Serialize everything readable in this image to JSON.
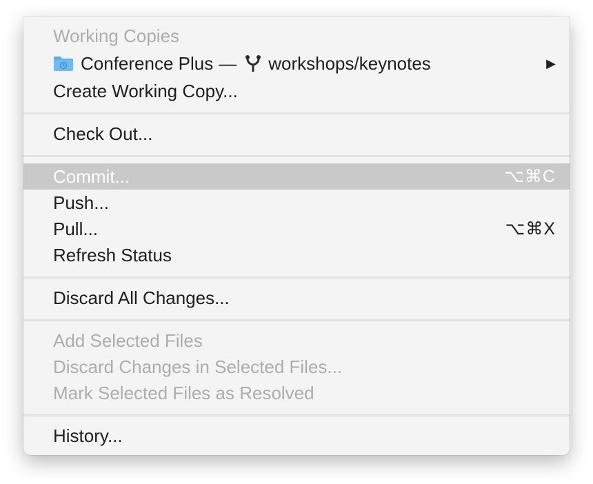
{
  "menu": {
    "header": "Working Copies",
    "working_copy": {
      "icon": "folder-icon",
      "name": "Conference Plus",
      "dash": "—",
      "branch_icon": "branch-icon",
      "branch": "workshops/keynotes",
      "submenu_indicator": "▶"
    },
    "create_working_copy": "Create Working Copy...",
    "check_out": "Check Out...",
    "commit": {
      "label": "Commit...",
      "shortcut": "⌥⌘C"
    },
    "push": "Push...",
    "pull": {
      "label": "Pull...",
      "shortcut": "⌥⌘X"
    },
    "refresh_status": "Refresh Status",
    "discard_all_changes": "Discard All Changes...",
    "add_selected_files": "Add Selected Files",
    "discard_changes_selected": "Discard Changes in Selected Files...",
    "mark_resolved": "Mark Selected Files as Resolved",
    "history": "History..."
  },
  "colors": {
    "menu_background": "#f4f4f4",
    "highlight": "#c9c9c9",
    "disabled_text": "#adadad",
    "folder_blue": "#5aaee6"
  }
}
